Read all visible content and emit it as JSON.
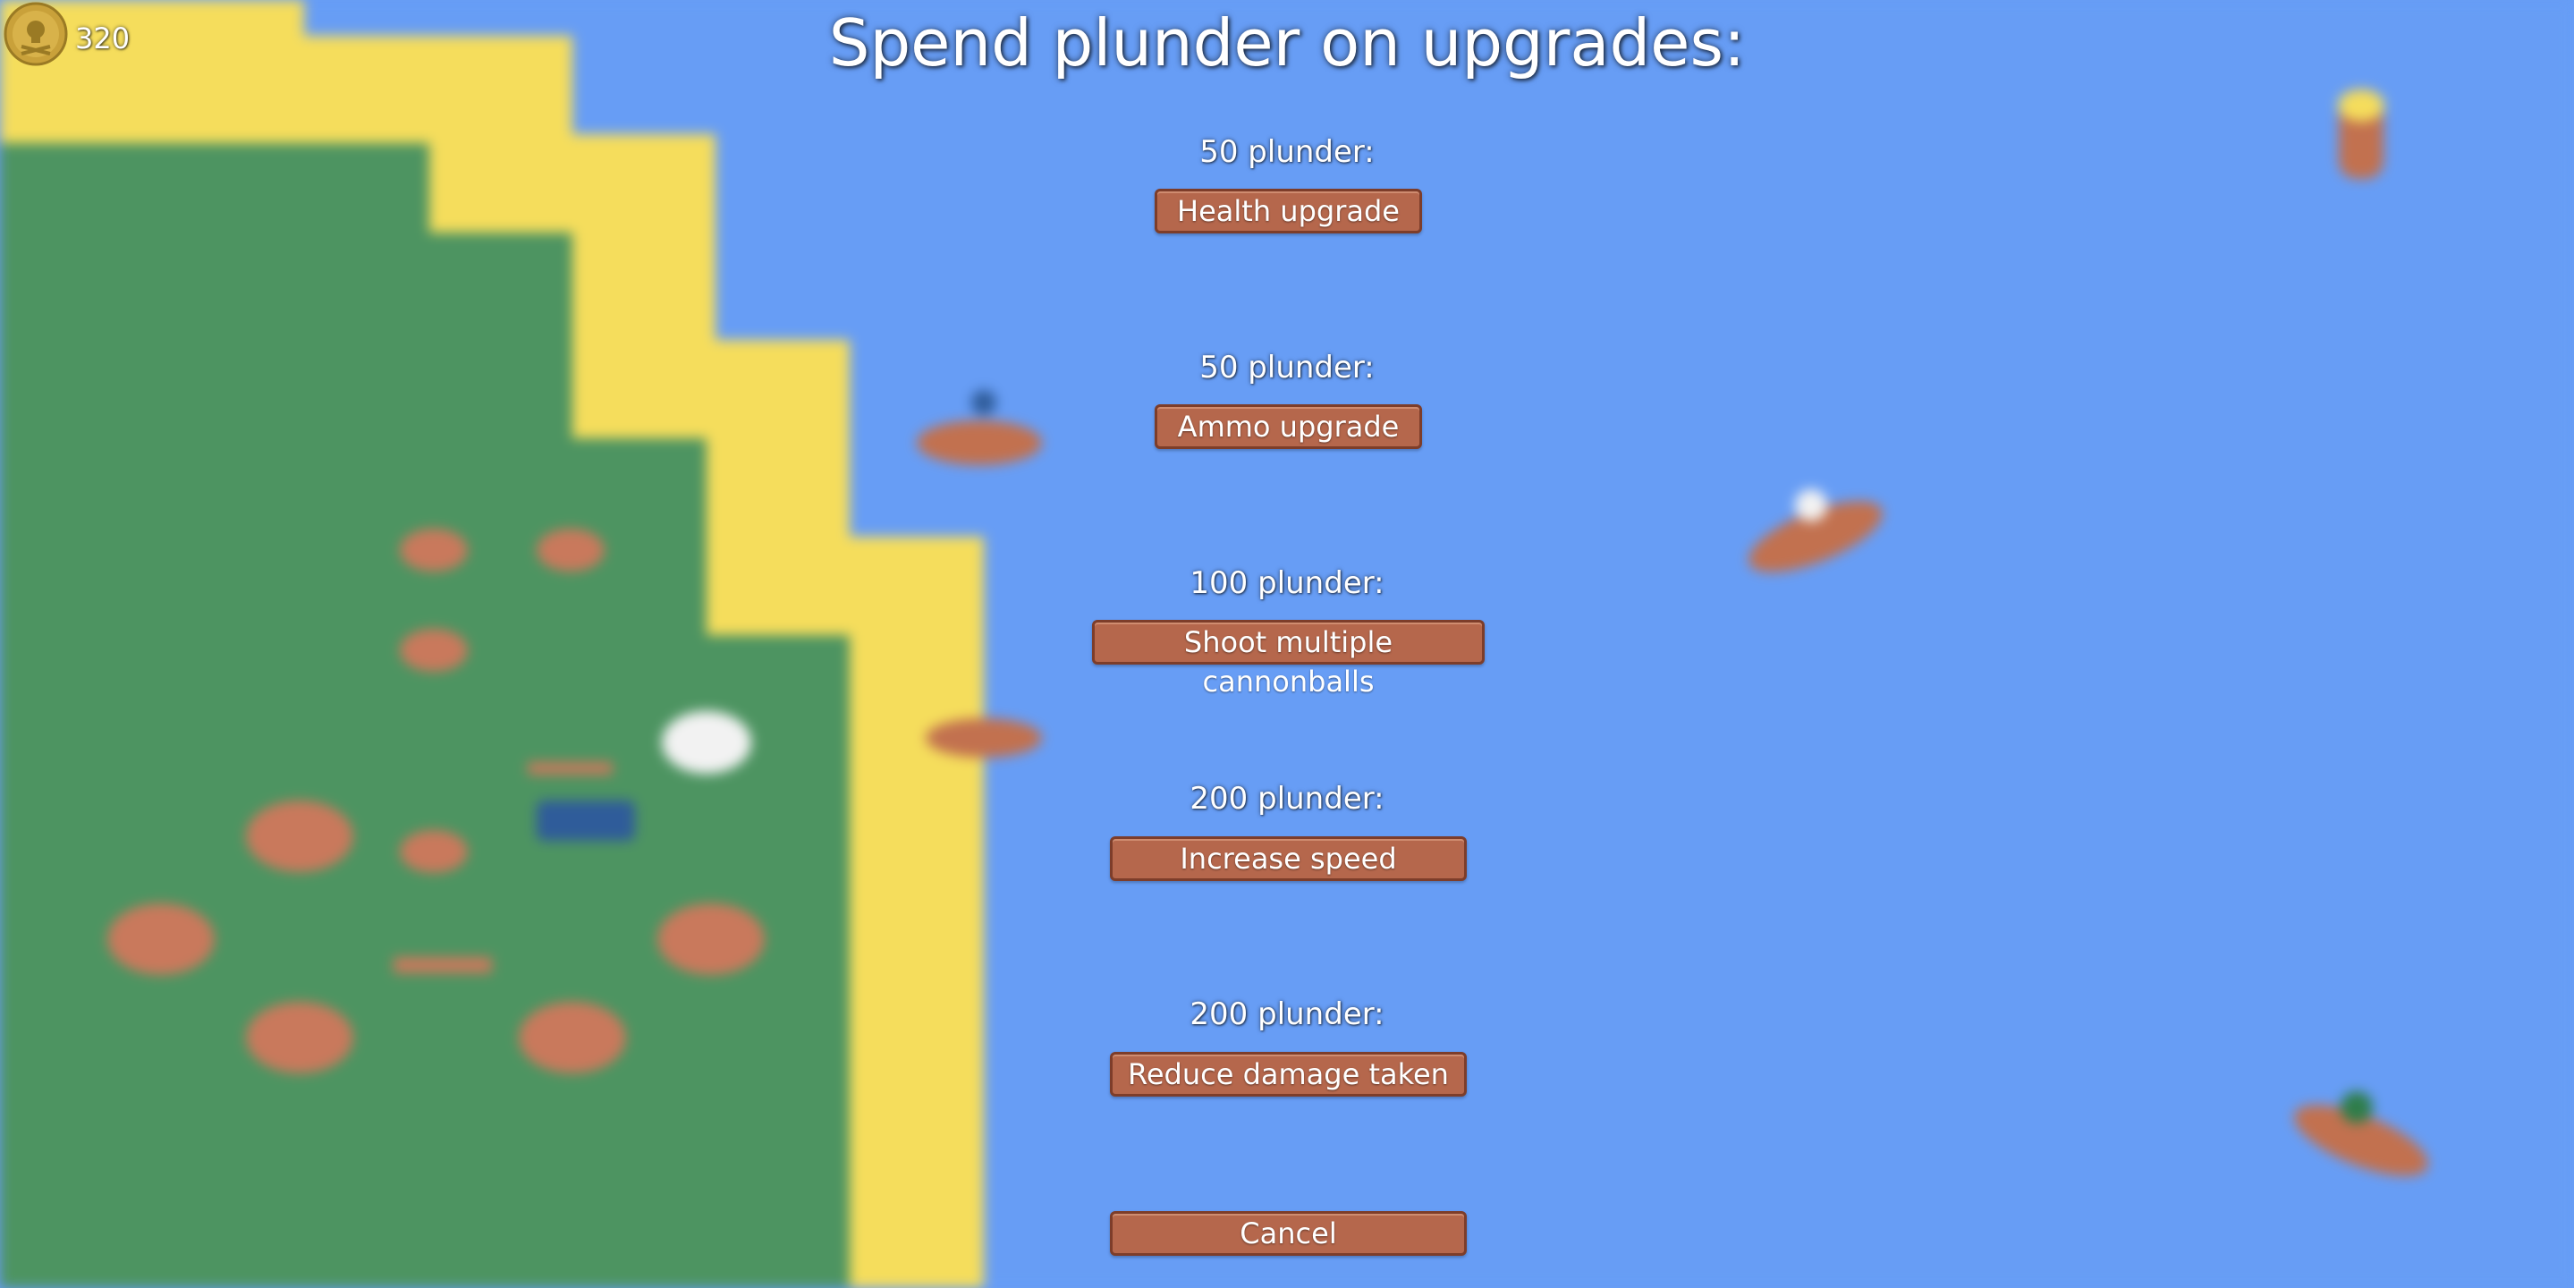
{
  "hud": {
    "plunder": "320"
  },
  "menu": {
    "title": "Spend plunder on upgrades:",
    "upgrades": [
      {
        "cost": "50 plunder:",
        "label": "Health upgrade"
      },
      {
        "cost": "50 plunder:",
        "label": "Ammo upgrade"
      },
      {
        "cost": "100 plunder:",
        "label": "Shoot multiple cannonballs"
      },
      {
        "cost": "200 plunder:",
        "label": "Increase speed"
      },
      {
        "cost": "200 plunder:",
        "label": "Reduce damage taken"
      }
    ],
    "cancel_label": "Cancel"
  },
  "colors": {
    "water": "#679df5",
    "sand": "#f5dd5c",
    "grass": "#4d9461",
    "button": "#b5674c",
    "button_border": "#7d3d2a",
    "text": "#ffffff"
  }
}
